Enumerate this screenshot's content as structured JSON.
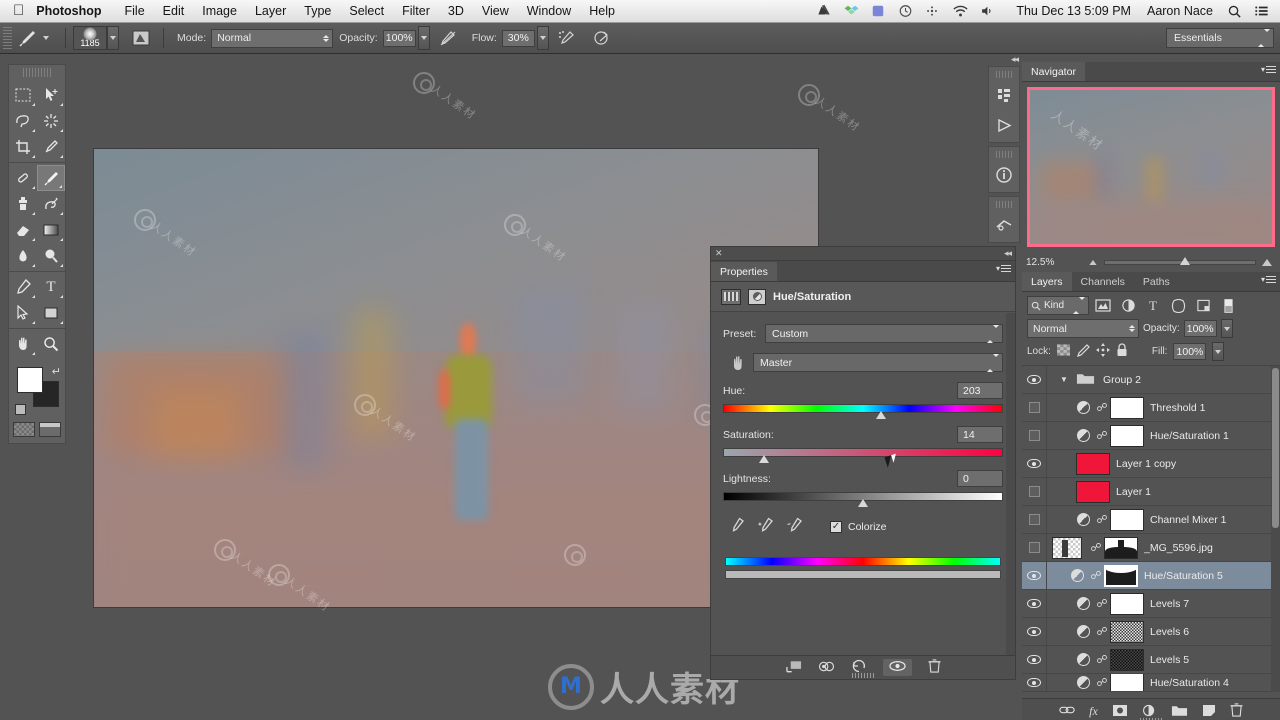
{
  "macbar": {
    "apple_icon": "apple-icon",
    "app_name": "Photoshop",
    "menus": [
      "File",
      "Edit",
      "Image",
      "Layer",
      "Type",
      "Select",
      "Filter",
      "3D",
      "View",
      "Window",
      "Help"
    ],
    "status_icons": [
      "google-drive-icon",
      "dropbox-icon",
      "display-color-icon",
      "time-machine-icon",
      "bluetooth-icon",
      "wifi-icon",
      "volume-icon"
    ],
    "clock": "Thu Dec 13  5:09 PM",
    "user": "Aaron Nace",
    "search_icon": "search-icon",
    "notification_icon": "notification-center-icon"
  },
  "optionsbar": {
    "tool_icon": "brush-tool-icon",
    "brush_size": "1185",
    "brush_panel_icon": "brush-panel-toggle-icon",
    "mode_label": "Mode:",
    "mode_value": "Normal",
    "opacity_label": "Opacity:",
    "opacity_value": "100%",
    "opacity_pressure_icon": "tablet-pressure-opacity-icon",
    "flow_label": "Flow:",
    "flow_value": "30%",
    "airbrush_icon": "airbrush-icon",
    "flow_pressure_icon": "tablet-pressure-size-icon",
    "workspace": "Essentials"
  },
  "toolbar": {
    "groups": [
      [
        {
          "name": "marquee-tool",
          "glyph": "▭"
        },
        {
          "name": "move-tool",
          "glyph": "➤"
        },
        {
          "name": "lasso-tool",
          "glyph": "𝒫"
        },
        {
          "name": "quick-selection-tool",
          "glyph": "✳"
        },
        {
          "name": "crop-tool",
          "glyph": "⌗"
        },
        {
          "name": "eyedropper-tool",
          "glyph": "✎"
        }
      ],
      [
        {
          "name": "spot-healing-brush-tool",
          "glyph": "✒"
        },
        {
          "name": "brush-tool",
          "glyph": "🖌",
          "selected": true
        },
        {
          "name": "clone-stamp-tool",
          "glyph": "⚲"
        },
        {
          "name": "history-brush-tool",
          "glyph": "✇"
        },
        {
          "name": "eraser-tool",
          "glyph": "◣"
        },
        {
          "name": "gradient-tool",
          "glyph": "▤"
        },
        {
          "name": "blur-tool",
          "glyph": "◗"
        },
        {
          "name": "dodge-tool",
          "glyph": "🔍"
        }
      ],
      [
        {
          "name": "pen-tool",
          "glyph": "✐"
        },
        {
          "name": "type-tool",
          "glyph": "T"
        },
        {
          "name": "path-selection-tool",
          "glyph": "➚"
        },
        {
          "name": "rectangle-tool",
          "glyph": "▢"
        }
      ],
      [
        {
          "name": "hand-tool",
          "glyph": "✋"
        },
        {
          "name": "zoom-tool",
          "glyph": "🔍"
        }
      ]
    ],
    "foreground_color": "#ffffff",
    "background_color": "#262626",
    "swap_icon": "swap-colors-icon",
    "reset_icon": "default-colors-icon",
    "quickmask_icon": "quick-mask-icon",
    "screenmode_icon": "screen-mode-icon"
  },
  "dock": {
    "items": [
      "history-panel-icon",
      "actions-panel-icon",
      "info-panel-icon",
      "adjustments-panel-icon"
    ],
    "collapse_icon": "collapse-panels-icon",
    "menu_icon": "panel-menu-icon"
  },
  "navigator": {
    "tab": "Navigator",
    "zoom_value": "12.5%",
    "zoom_out_icon": "zoom-out-icon",
    "zoom_in_icon": "zoom-in-icon",
    "view_box_color": "#ff6b8a",
    "menu_icon": "panel-menu-icon"
  },
  "layers": {
    "tabs": [
      "Layers",
      "Channels",
      "Paths"
    ],
    "active_tab": "Layers",
    "filter_label": "Kind",
    "filter_icons": [
      "filter-pixel-icon",
      "filter-adjustment-icon",
      "filter-type-icon",
      "filter-shape-icon",
      "filter-smartobject-icon",
      "filter-toggle-icon"
    ],
    "blend_mode": "Normal",
    "opacity_label": "Opacity:",
    "opacity_value": "100%",
    "lock_label": "Lock:",
    "lock_icons": [
      "lock-transparency-icon",
      "lock-image-icon",
      "lock-position-icon",
      "lock-all-icon"
    ],
    "fill_label": "Fill:",
    "fill_value": "100%",
    "rows": [
      {
        "name": "Group 2",
        "type": "group",
        "visible": true,
        "expanded": true,
        "selected": false
      },
      {
        "name": "Threshold 1",
        "type": "adjustment",
        "visible": false,
        "selected": false,
        "thumb": "white"
      },
      {
        "name": "Hue/Saturation 1",
        "type": "adjustment",
        "visible": false,
        "selected": false,
        "thumb": "white"
      },
      {
        "name": "Layer 1 copy",
        "type": "pixel",
        "visible": true,
        "selected": false,
        "thumb": "red"
      },
      {
        "name": "Layer 1",
        "type": "pixel",
        "visible": false,
        "selected": false,
        "thumb": "red"
      },
      {
        "name": "Channel Mixer 1",
        "type": "adjustment",
        "visible": false,
        "selected": false,
        "thumb": "white"
      },
      {
        "name": "_MG_5596.jpg",
        "type": "smart",
        "visible": false,
        "selected": false,
        "thumb": "photo"
      },
      {
        "name": "Hue/Saturation 5",
        "type": "adjustment",
        "visible": true,
        "selected": true,
        "thumb": "maskcurve"
      },
      {
        "name": "Levels 7",
        "type": "adjustment",
        "visible": true,
        "selected": false,
        "thumb": "white"
      },
      {
        "name": "Levels 6",
        "type": "adjustment",
        "visible": true,
        "selected": false,
        "thumb": "noise"
      },
      {
        "name": "Levels 5",
        "type": "adjustment",
        "visible": true,
        "selected": false,
        "thumb": "darknoise"
      },
      {
        "name": "Hue/Saturation 4",
        "type": "adjustment",
        "visible": true,
        "selected": false,
        "thumb": "white"
      }
    ],
    "footer_icons": [
      "link-layers-icon",
      "layer-style-icon",
      "layer-mask-icon",
      "new-adjustment-layer-icon",
      "new-group-icon",
      "new-layer-icon",
      "delete-layer-icon"
    ]
  },
  "properties": {
    "close_icon": "close-icon",
    "collapse_icon": "collapse-to-icons-icon",
    "tab": "Properties",
    "menu_icon": "panel-menu-icon",
    "adjustment_icon": "hue-saturation-adjustment-icon",
    "mask_icon": "layer-mask-icon",
    "title": "Hue/Saturation",
    "preset_label": "Preset:",
    "preset_value": "Custom",
    "hand_icon": "targeted-adjustment-icon",
    "channel_value": "Master",
    "hue_label": "Hue:",
    "hue_value": "203",
    "saturation_label": "Saturation:",
    "saturation_value": "14",
    "lightness_label": "Lightness:",
    "lightness_value": "0",
    "eyedropper_icons": [
      "eyedropper-icon",
      "eyedropper-add-icon",
      "eyedropper-subtract-icon"
    ],
    "colorize_label": "Colorize",
    "colorize_checked": true,
    "footer_icons": [
      "clip-to-layer-icon",
      "previous-state-icon",
      "reset-icon",
      "toggle-visibility-icon",
      "delete-adjustment-icon"
    ]
  },
  "watermark": {
    "text": "人人素材",
    "mark": "M",
    "tile_text": "人人素材"
  }
}
